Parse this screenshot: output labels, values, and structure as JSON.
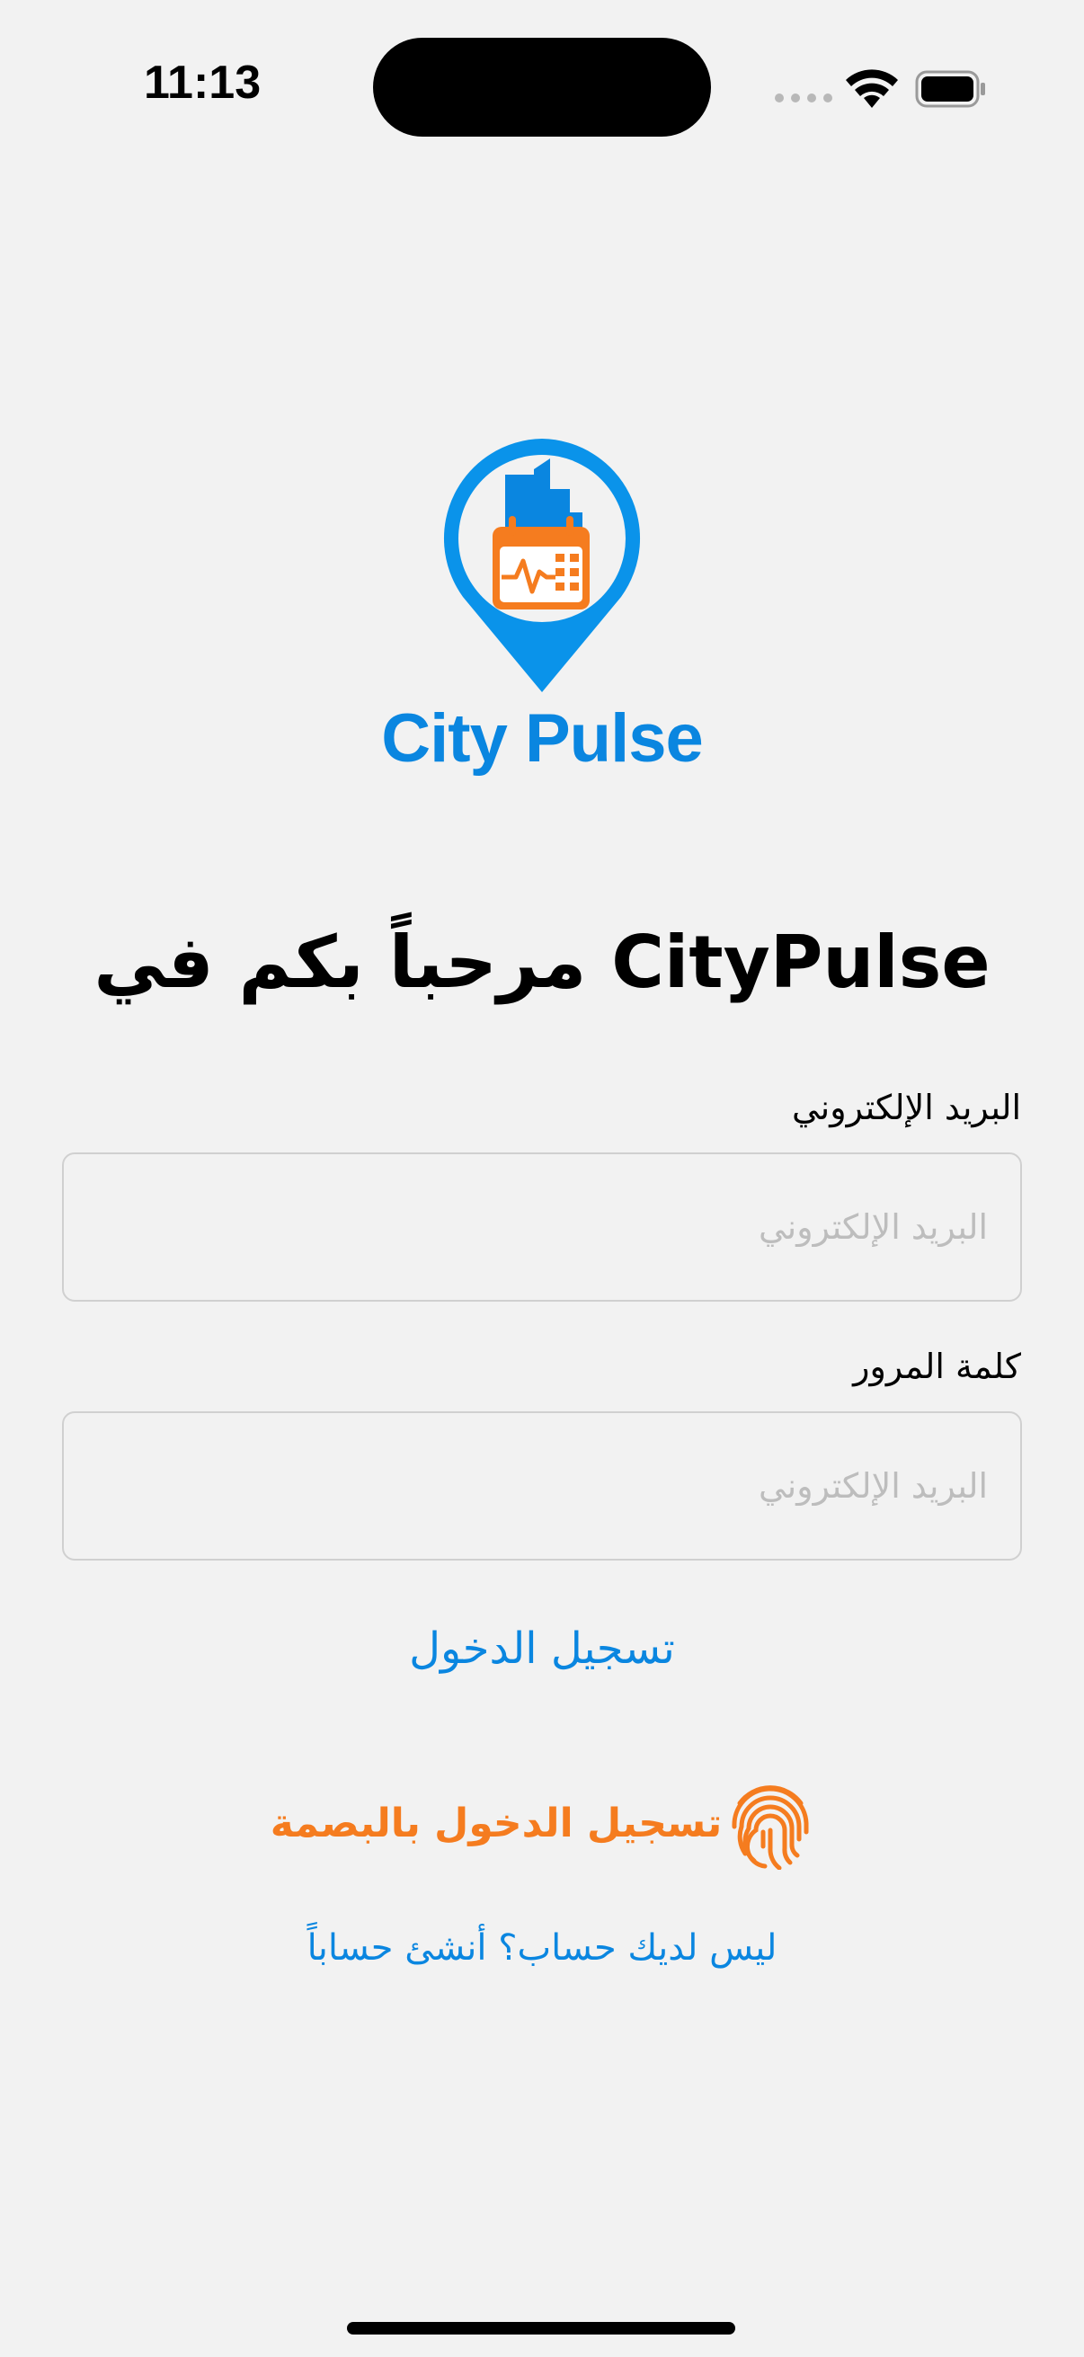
{
  "status_bar": {
    "time": "11:13"
  },
  "logo": {
    "app_name": "City Pulse"
  },
  "welcome": {
    "title": "مرحباً بكم في CityPulse"
  },
  "form": {
    "email_label": "البريد الإلكتروني",
    "email_placeholder": "البريد الإلكتروني",
    "email_value": "",
    "password_label": "كلمة المرور",
    "password_placeholder": "البريد الإلكتروني",
    "password_value": ""
  },
  "actions": {
    "login_label": "تسجيل الدخول",
    "fingerprint_login_label": "تسجيل الدخول بالبصمة",
    "signup_link": "ليس لديك حساب؟ أنشئ حساباً"
  },
  "colors": {
    "primary_blue": "#0a86e0",
    "accent_orange": "#f57c1f",
    "background": "#f2f2f2"
  },
  "icons": {
    "logo": "map-pin-calendar-icon",
    "fingerprint": "fingerprint-icon",
    "wifi": "wifi-icon",
    "battery": "battery-icon"
  }
}
